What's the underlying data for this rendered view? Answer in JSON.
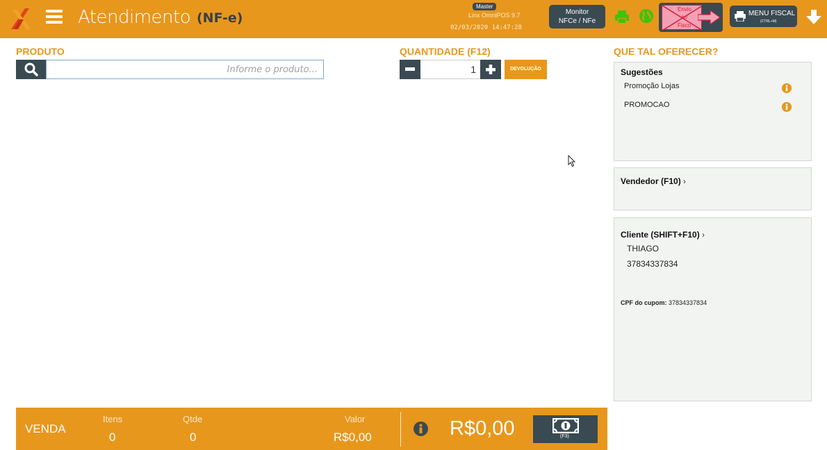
{
  "header": {
    "title": "Atendimento",
    "subtitle": "(NF-e)",
    "user_badge": "Master",
    "version": "Linx OmniPOS 9.7",
    "datetime": "02/03/2020 14:47:28",
    "monitor_line1": "Monitor",
    "monitor_line2": "NFCe / NFe",
    "envio_line1": "Envio",
    "envio_line2": "ao",
    "envio_line3": "Fisco",
    "fiscal_label": "MENU FISCAL",
    "fiscal_shortcut": "(CTRL+M)"
  },
  "product": {
    "label": "PRODUTO",
    "placeholder": "Informe o produto..."
  },
  "quantity": {
    "label": "QUANTIDADE (F12)",
    "value": "1",
    "devolucao_label": "DEVOLUÇÃO"
  },
  "sidebar": {
    "title": "QUE TAL OFERECER?",
    "suggestions_title": "Sugestões",
    "suggestions": [
      "Promoção Lojas",
      "PROMOCAO"
    ],
    "vendedor_title": "Vendedor (F10)",
    "cliente_title": "Cliente (SHIFT+F10)",
    "cliente_name": "THIAGO",
    "cliente_doc": "37834337834",
    "cpf_label": "CPF do cupom:",
    "cpf_value": "37834337834"
  },
  "footer": {
    "venda_label": "VENDA",
    "itens_label": "Itens",
    "itens_value": "0",
    "qtde_label": "Qtde",
    "qtde_value": "0",
    "valor_label": "Valor",
    "valor_value": "R$0,00",
    "total": "R$0,00",
    "pay_shortcut": "(F3)"
  },
  "colors": {
    "accent": "#e8971d",
    "dark": "#3a4a52",
    "alert": "#d02040",
    "ok": "#3ec40a"
  }
}
